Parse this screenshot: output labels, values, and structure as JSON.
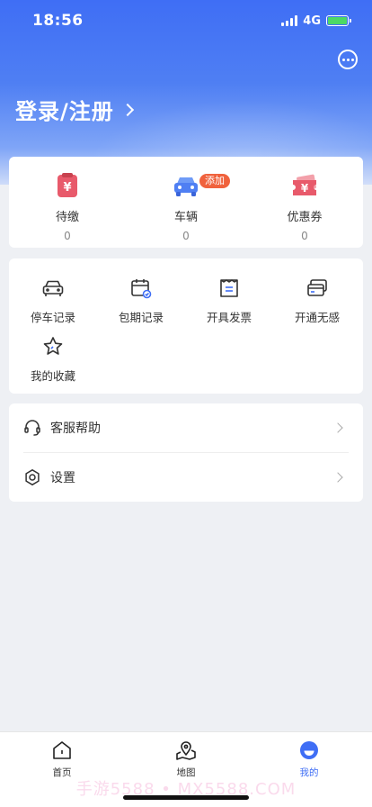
{
  "status_bar": {
    "time": "18:56",
    "network": "4G"
  },
  "header": {
    "login_text": "登录/注册"
  },
  "stats": [
    {
      "label": "待缴",
      "value": "0"
    },
    {
      "label": "车辆",
      "value": "0",
      "badge": "添加"
    },
    {
      "label": "优惠券",
      "value": "0"
    }
  ],
  "services": [
    {
      "label": "停车记录"
    },
    {
      "label": "包期记录"
    },
    {
      "label": "开具发票"
    },
    {
      "label": "开通无感"
    },
    {
      "label": "我的收藏"
    }
  ],
  "menu": [
    {
      "label": "客服帮助"
    },
    {
      "label": "设置"
    }
  ],
  "tabs": [
    {
      "label": "首页"
    },
    {
      "label": "地图"
    },
    {
      "label": "我的"
    }
  ],
  "watermark": "手游5588 • MX5588.COM",
  "colors": {
    "primary": "#3f6ef5",
    "badge": "#f0623d",
    "icon_red": "#e85a6b"
  }
}
